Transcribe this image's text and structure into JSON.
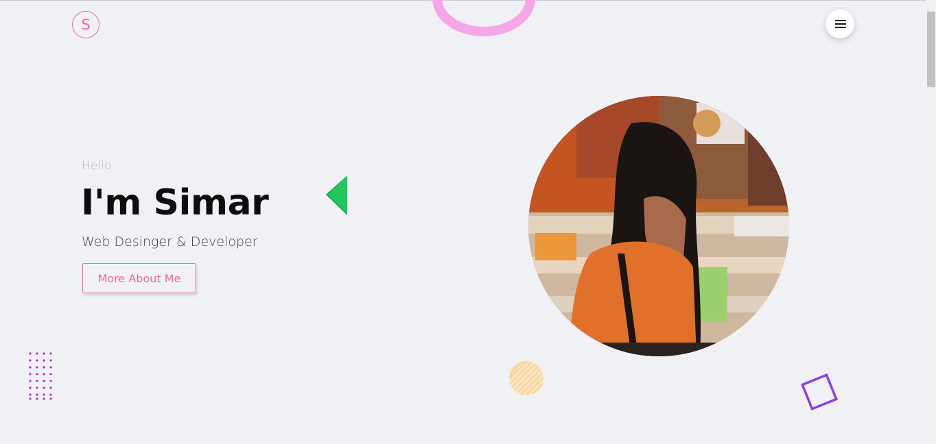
{
  "header": {
    "logo_letter": "S",
    "menu_icon": "hamburger-icon"
  },
  "hero": {
    "greeting": "Hello",
    "headline": "I'm Simar",
    "subtitle": "Web Desinger & Developer",
    "cta_label": "More About Me"
  },
  "colors": {
    "background": "#f0f1f5",
    "accent": "#f06b8f",
    "heading": "#0d0d0d",
    "ring_pink": "#f5a6e8",
    "triangle_green": "#22c55e",
    "dots_magenta": "#c026d3",
    "circle_orange": "#f6cf8f",
    "square_purple": "#8b3fe6"
  },
  "decorations": [
    "pink-ring",
    "green-triangle",
    "dot-grid",
    "striped-circle",
    "rotated-square"
  ]
}
